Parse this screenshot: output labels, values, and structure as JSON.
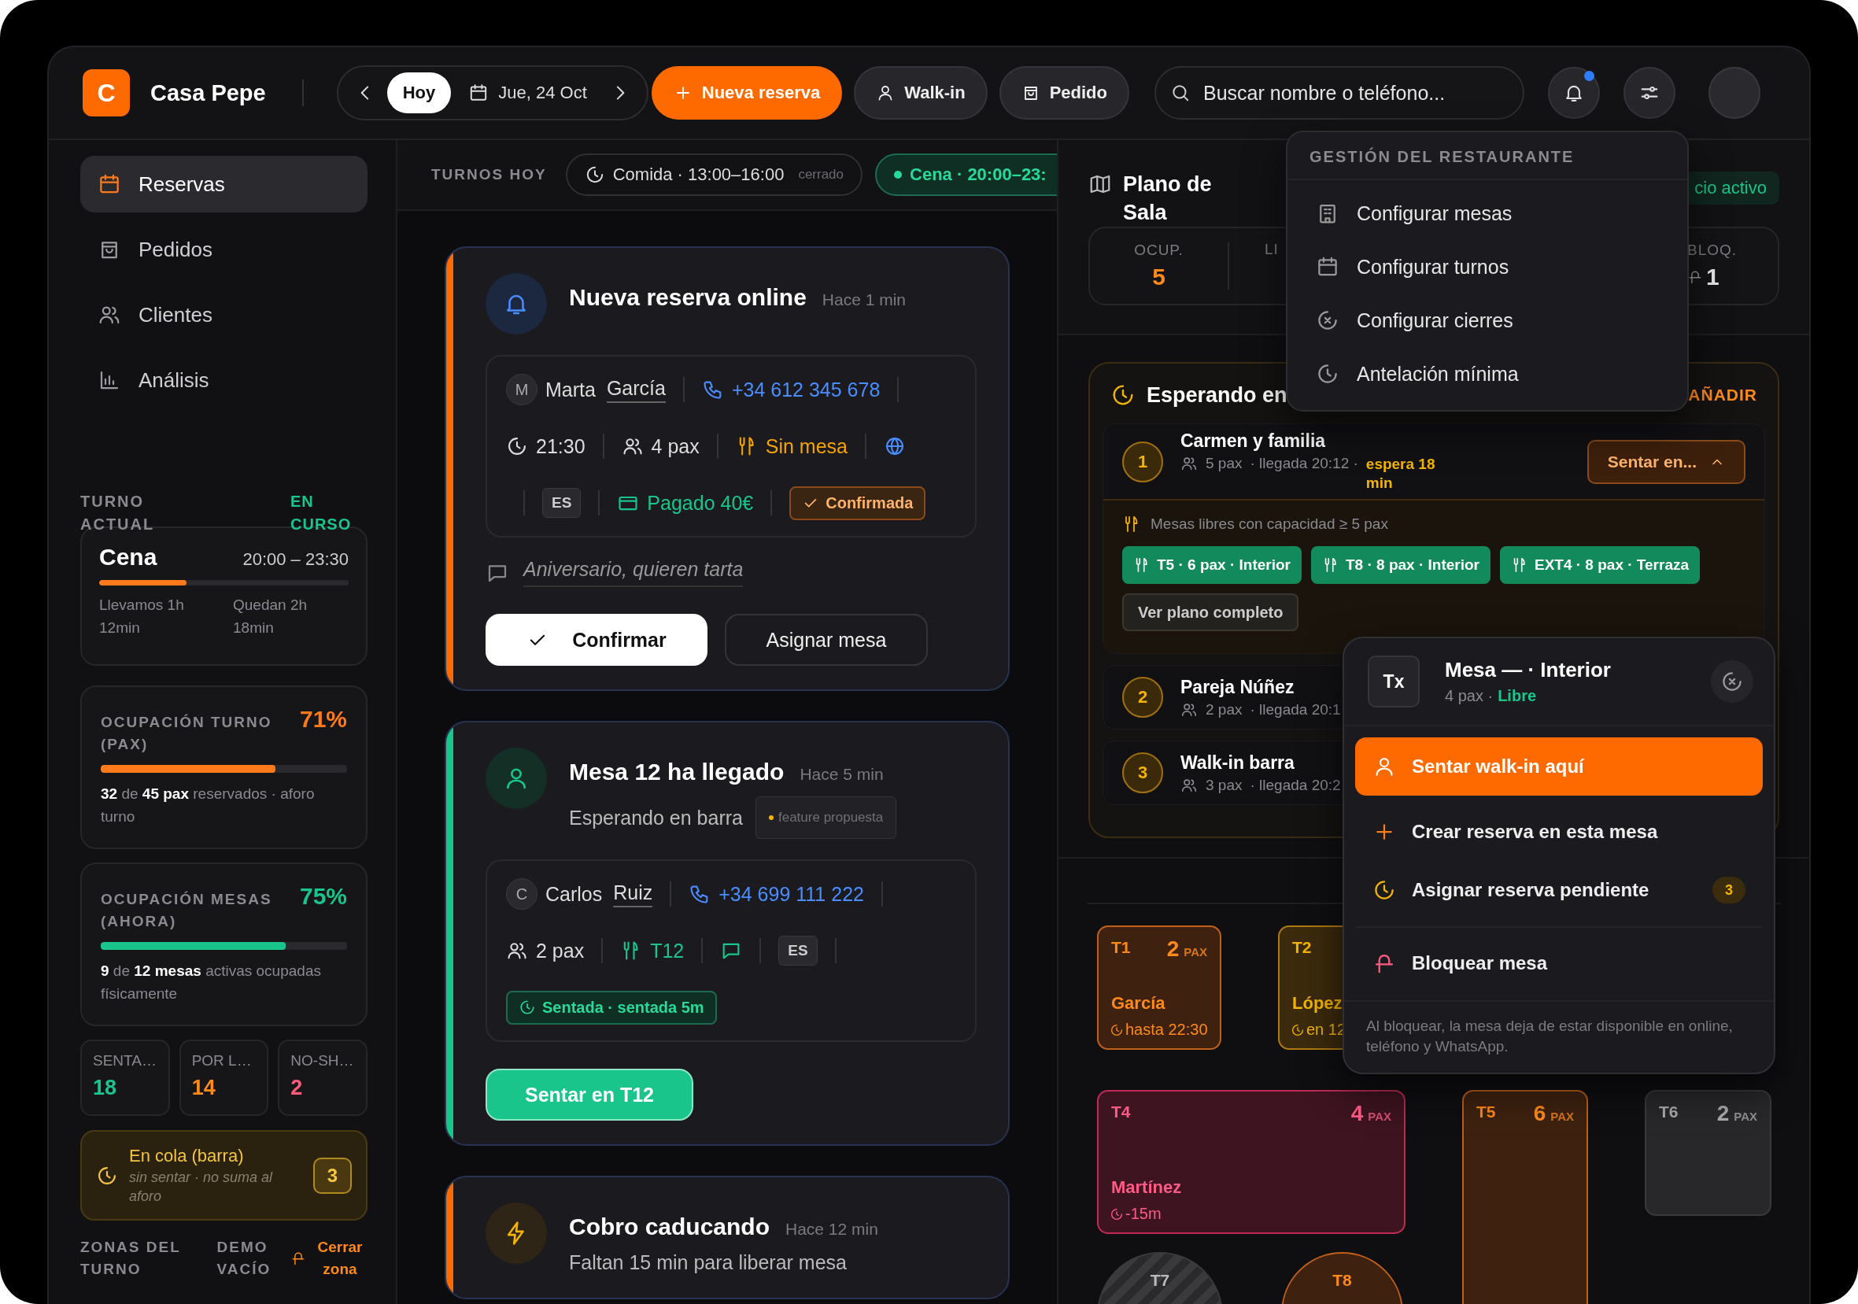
{
  "header": {
    "logo": "C",
    "name": "Casa Pepe",
    "today": "Hoy",
    "date": "Jue, 24 Oct",
    "actions": [
      {
        "label": "Nueva reserva",
        "kind": "new"
      },
      {
        "label": "Walk-in",
        "kind": "walkin"
      },
      {
        "label": "Pedido",
        "kind": "order"
      }
    ],
    "search": {
      "placeholder": "Buscar nombre o teléfono..."
    },
    "notifications": {
      "unread": true
    }
  },
  "sidebar": {
    "items": [
      {
        "label": "Reservas",
        "selected": true
      },
      {
        "label": "Pedidos",
        "selected": false
      },
      {
        "label": "Clientes",
        "selected": false
      },
      {
        "label": "Análisis",
        "selected": false
      }
    ],
    "current_shift": {
      "heading": "TURNO ACTUAL",
      "status": "EN CURSO",
      "name": "Cena",
      "hours": "20:00 – 23:30",
      "level": 0.35,
      "elapsed": "Llevamos 1h 12min",
      "remaining": "Quedan 2h 18min"
    },
    "occupancy": [
      {
        "title": "OCUPACIÓN TURNO (PAX)",
        "percent": "71%",
        "color": "#ff7a1a",
        "level": 0.71,
        "note": "**32** de **45 pax** reservados · aforo turno"
      },
      {
        "title": "OCUPACIÓN MESAS (AHORA)",
        "percent": "75%",
        "color": "#19c58a",
        "level": 0.75,
        "note": "**9** de **12 mesas** activas ocupadas físicamente"
      }
    ],
    "counters": [
      {
        "label": "SENTA…",
        "value": "18",
        "color": "#19c58a"
      },
      {
        "label": "POR L…",
        "value": "14",
        "color": "#ff8a1a"
      },
      {
        "label": "NO-SH…",
        "value": "2",
        "color": "#ff5b7a"
      }
    ],
    "queue": {
      "title": "En cola (barra)",
      "subtitle": "sin sentar · no suma al aforo",
      "count": "3"
    },
    "zones": {
      "heading": "ZONAS DEL TURNO",
      "demo": "DEMO VACÍO",
      "action": "Cerrar zona"
    }
  },
  "shifts": {
    "heading": "TURNOS HOY",
    "items": [
      {
        "label": "Comida · 13:00–16:00",
        "status": "cerrado",
        "selected": false
      },
      {
        "label": "Cena · 20:00–23:",
        "selected": true
      }
    ]
  },
  "feed": [
    {
      "kind": "booking",
      "title": "Nueva reserva online",
      "time": "Hace 1 min",
      "guest": {
        "initial": "M",
        "first_name": "Marta",
        "last_name": "García",
        "phone": "+34 612 345 678",
        "chips": [
          {
            "kind": "time",
            "text": "21:30"
          },
          {
            "kind": "pax",
            "text": "4 pax"
          },
          {
            "kind": "table",
            "text": "Sin mesa",
            "assigned": false
          },
          {
            "kind": "web"
          },
          {
            "kind": "lang",
            "text": "ES"
          },
          {
            "kind": "paid",
            "text": "Pagado 40€"
          },
          {
            "kind": "confirmed",
            "text": "Confirmada"
          }
        ]
      },
      "note": "Aniversario, quieren tarta",
      "buttons": [
        {
          "label": "Confirmar",
          "kind": "confirm"
        },
        {
          "label": "Asignar mesa",
          "kind": "secondary"
        }
      ]
    },
    {
      "kind": "arrival",
      "title": "Mesa 12 ha llegado",
      "time": "Hace 5 min",
      "subtitle": "Esperando en barra",
      "tag": "feature propuesta",
      "guest": {
        "initial": "C",
        "first_name": "Carlos",
        "last_name": "Ruiz",
        "phone": "+34 699 111 222",
        "chips": [
          {
            "kind": "pax",
            "text": "2 pax"
          },
          {
            "kind": "table",
            "text": "T12",
            "assigned": true
          },
          {
            "kind": "chat"
          },
          {
            "kind": "lang",
            "text": "ES"
          },
          {
            "kind": "seated",
            "text": "Sentada · sentada 5m"
          }
        ]
      },
      "buttons": [
        {
          "label": "Sentar en T12",
          "kind": "seat"
        }
      ]
    },
    {
      "kind": "payment",
      "title": "Cobro caducando",
      "time": "Hace 12 min",
      "subtitle": "Faltan 15 min para liberar mesa"
    }
  ],
  "floor_plan": {
    "title": "Plano de Sala",
    "badge": "cio activo",
    "stats": [
      {
        "label": "OCUP.",
        "value": "5",
        "kind": "occupied"
      },
      {
        "label": "LI",
        "kind": "free"
      },
      {
        "label": "BLOQ.",
        "value": "1",
        "kind": "blocked"
      }
    ],
    "waitlist": {
      "title": "Esperando en",
      "action": "AÑADIR",
      "entries": [
        {
          "number": "1",
          "name": "Carmen y familia",
          "pax": "5 pax",
          "arrival": "· llegada 20:12 ·",
          "wait": "espera 18 min",
          "action": "Sentar en...",
          "expanded": true,
          "hint": "Mesas libres con capacidad ≥ 5 pax",
          "suggestions": [
            "T5 · 6 pax · Interior",
            "T8 · 8 pax · Interior",
            "EXT4 · 8 pax · Terraza"
          ],
          "more": "Ver plano completo"
        },
        {
          "number": "2",
          "name": "Pareja Núñez",
          "pax": "2 pax",
          "arrival": "· llegada 20:1",
          "expanded": false
        },
        {
          "number": "3",
          "name": "Walk-in barra",
          "pax": "3 pax",
          "arrival": "· llegada 20:2",
          "expanded": false
        }
      ]
    },
    "tables": [
      {
        "code": "T1",
        "pax": "2",
        "unit": "PAX",
        "kind": "reserved",
        "guest": "García",
        "info": "hasta 22:30"
      },
      {
        "code": "T2",
        "kind": "arriving",
        "guest": "López",
        "info": "en 12"
      },
      {
        "code": "T4",
        "pax": "4",
        "unit": "PAX",
        "kind": "late",
        "guest": "Martínez",
        "info": "-15m"
      },
      {
        "code": "T5",
        "pax": "6",
        "unit": "PAX",
        "kind": "reserved"
      },
      {
        "code": "T6",
        "pax": "2",
        "unit": "PAX",
        "kind": "free"
      },
      {
        "code": "T7",
        "kind": "blocked"
      },
      {
        "code": "T8",
        "kind": "reserved"
      }
    ]
  },
  "admin_menu": {
    "heading": "GESTIÓN DEL RESTAURANTE",
    "items": [
      {
        "label": "Configurar mesas"
      },
      {
        "label": "Configurar turnos"
      },
      {
        "label": "Configurar cierres"
      },
      {
        "label": "Antelación mínima"
      }
    ]
  },
  "table_popover": {
    "code": "Tx",
    "title": "Mesa — · Interior",
    "capacity": "4 pax ·",
    "status": "Libre",
    "actions": [
      {
        "label": "Sentar walk-in aquí",
        "kind": "primary"
      },
      {
        "label": "Crear reserva en esta mesa",
        "kind": "create"
      },
      {
        "label": "Asignar reserva pendiente",
        "kind": "assign",
        "count": "3"
      },
      {
        "label": "Bloquear mesa",
        "kind": "block"
      }
    ],
    "footnote": "Al bloquear, la mesa deja de estar disponible en online, teléfono y WhatsApp."
  }
}
